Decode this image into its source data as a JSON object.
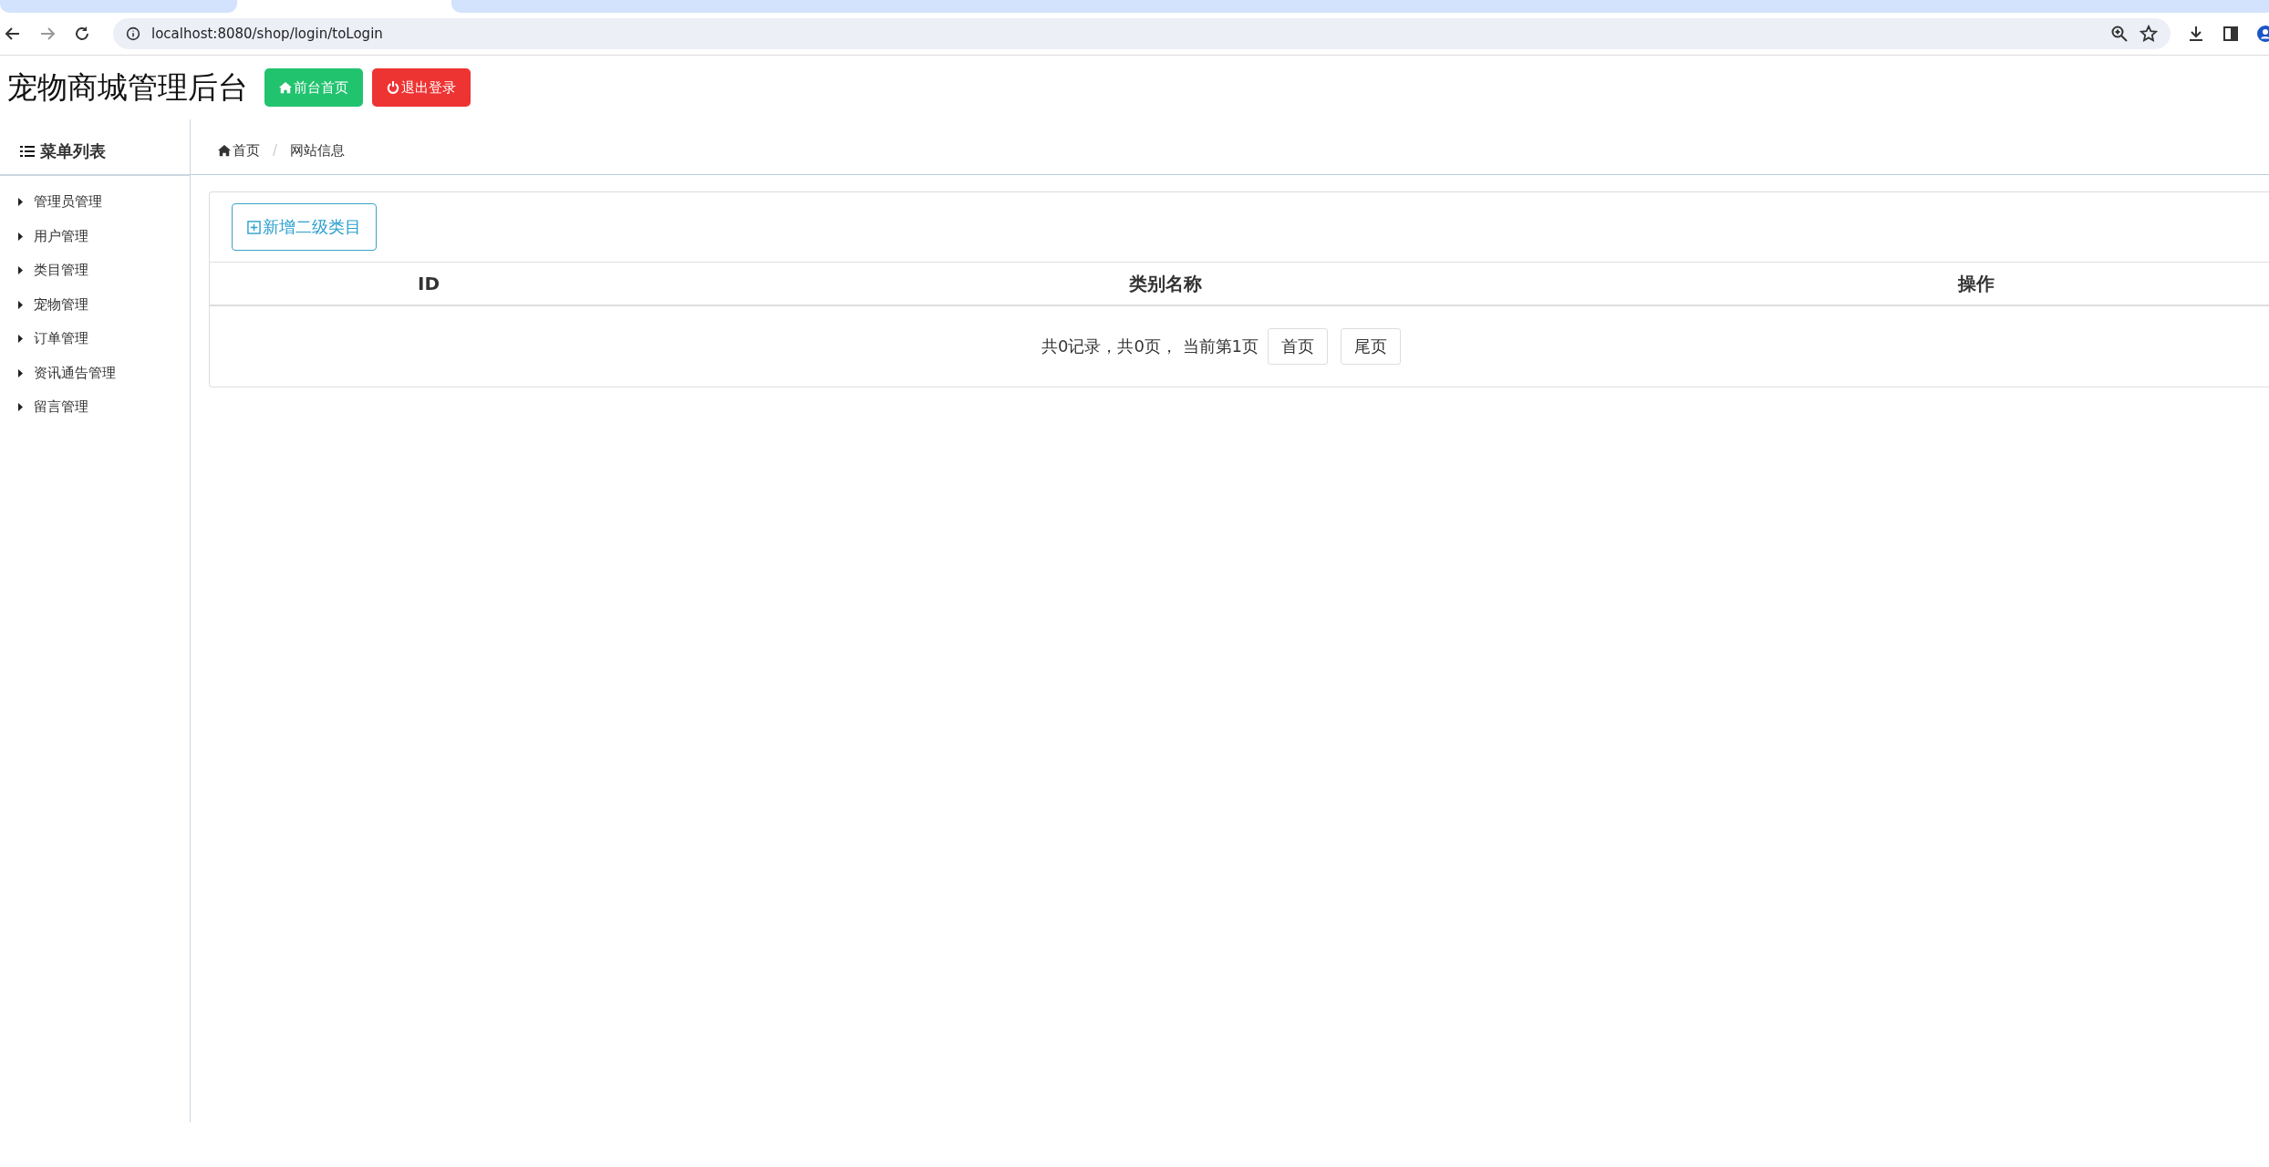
{
  "browser": {
    "url": "localhost:8080/shop/login/toLogin"
  },
  "header": {
    "title": "宠物商城管理后台",
    "buttons": [
      {
        "label": "前台首页",
        "kind": "home"
      },
      {
        "label": "退出登录",
        "kind": "logout"
      }
    ]
  },
  "sidebar": {
    "title": "菜单列表",
    "items": [
      {
        "label": "管理员管理"
      },
      {
        "label": "用户管理"
      },
      {
        "label": "类目管理"
      },
      {
        "label": "宠物管理"
      },
      {
        "label": "订单管理"
      },
      {
        "label": "资讯通告管理"
      },
      {
        "label": "留言管理"
      }
    ]
  },
  "breadcrumb_separator": "/",
  "breadcrumb": [
    {
      "label": "首页",
      "kind": "home"
    },
    {
      "label": "网站信息",
      "kind": "page"
    }
  ],
  "add_button": {
    "label": "新增二级类目"
  },
  "table": {
    "columns": [
      "ID",
      "类别名称",
      "操作"
    ]
  },
  "pagination": {
    "summary": "共0记录，共0页， 当前第1页",
    "buttons": [
      "首页",
      "尾页"
    ]
  }
}
